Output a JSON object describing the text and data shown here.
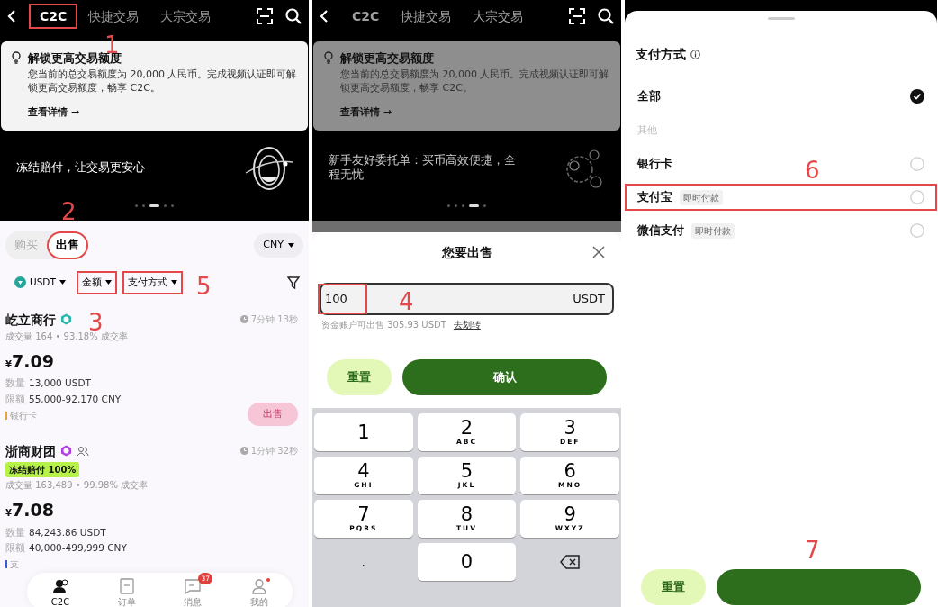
{
  "panels": [
    {
      "kind": "market",
      "header": {
        "tabs": [
          {
            "label": "C2C",
            "selected": true,
            "highlighted": true
          },
          {
            "label": "快捷交易",
            "selected": false,
            "highlighted": false
          },
          {
            "label": "大宗交易",
            "selected": false,
            "highlighted": false
          }
        ]
      },
      "notice": {
        "title": "解锁更高交易额度",
        "body": "您当前的总交易额度为 20,000 人民币。完成视频认证即可解锁更高交易额度，畅享 C2C。",
        "link": "查看详情 →"
      },
      "banner": {
        "text": "冻结赔付，让交易更安心",
        "kind": "ring",
        "dots": [
          {
            "selected": false
          },
          {
            "selected": false
          },
          {
            "selected": true
          },
          {
            "selected": false
          },
          {
            "selected": false
          }
        ]
      },
      "side_tabs": [
        {
          "label": "购买",
          "selected": false,
          "highlighted": false
        },
        {
          "label": "出售",
          "selected": true,
          "highlighted": true
        }
      ],
      "currency": "CNY",
      "filters": [
        {
          "label": "USDT",
          "kind": "coin",
          "highlighted": false
        },
        {
          "label": "金额",
          "kind": "plain",
          "highlighted": true
        },
        {
          "label": "支付方式",
          "kind": "plain",
          "highlighted": true
        }
      ],
      "offers": [
        {
          "name": "屹立商行",
          "badge": {
            "color": "#2bb5ad"
          },
          "group": false,
          "timer": "7分钟 13秒",
          "stats": "成交量 164 • 93.18% 成交率",
          "currency_sign": "¥",
          "price": "7.09",
          "quantity_label": "数量",
          "quantity": "13,000 USDT",
          "limit_label": "限额",
          "limit": "55,000-92,170 CNY",
          "payment": {
            "label": "银行卡",
            "color": "#f0a030"
          },
          "button": "出售"
        },
        {
          "name": "浙商财团",
          "badge": {
            "color": "#b040e0"
          },
          "group": true,
          "tag": "冻结赔付 100%",
          "timer": "1分钟 32秒",
          "stats": "成交量 163,489 • 99.98% 成交率",
          "currency_sign": "¥",
          "price": "7.08",
          "quantity_label": "数量",
          "quantity": "84,243.86 USDT",
          "limit_label": "限额",
          "limit": "40,000-499,999 CNY",
          "payment": {
            "label": "支",
            "color": "#3a5bd9"
          }
        }
      ],
      "bottom_nav": [
        {
          "label": "C2C",
          "selected": true,
          "dot": false
        },
        {
          "label": "订单",
          "selected": false,
          "dot": false
        },
        {
          "label": "消息",
          "selected": false,
          "badge": "37",
          "dot": false
        },
        {
          "label": "我的",
          "selected": false,
          "dot": true
        }
      ],
      "annotations": [
        "1",
        "2",
        "3",
        "5"
      ]
    },
    {
      "kind": "sell_sheet",
      "header": {
        "tabs": [
          {
            "label": "C2C",
            "selected": true,
            "highlighted": false
          },
          {
            "label": "快捷交易",
            "selected": false,
            "highlighted": false
          },
          {
            "label": "大宗交易",
            "selected": false,
            "highlighted": false
          }
        ]
      },
      "notice": {
        "title": "解锁更高交易额度",
        "body": "您当前的总交易额度为 20,000 人民币。完成视频认证即可解锁更高交易额度，畅享 C2C。",
        "link": "查看详情 →"
      },
      "banner": {
        "text": "新手友好委托单：买币高效便捷，全程无忧",
        "kind": "people",
        "dots": [
          {
            "selected": false
          },
          {
            "selected": false
          },
          {
            "selected": false
          },
          {
            "selected": true
          },
          {
            "selected": false
          }
        ]
      },
      "sheet": {
        "title": "您要出售",
        "amount": {
          "value": "100",
          "unit": "USDT",
          "highlighted": true
        },
        "hint": "资金账户可出售 305.93 USDT",
        "link": "去划转",
        "buttons": [
          {
            "label": "重置",
            "kind": "secondary"
          },
          {
            "label": "确认",
            "kind": "primary"
          }
        ]
      },
      "keypad": [
        {
          "kind": "key",
          "digit": "1"
        },
        {
          "kind": "key",
          "digit": "2",
          "letters": "ABC"
        },
        {
          "kind": "key",
          "digit": "3",
          "letters": "DEF"
        },
        {
          "kind": "key",
          "digit": "4",
          "letters": "GHI"
        },
        {
          "kind": "key",
          "digit": "5",
          "letters": "JKL"
        },
        {
          "kind": "key",
          "digit": "6",
          "letters": "MNO"
        },
        {
          "kind": "key",
          "digit": "7",
          "letters": "PQRS"
        },
        {
          "kind": "key",
          "digit": "8",
          "letters": "TUV"
        },
        {
          "kind": "key",
          "digit": "9",
          "letters": "WXYZ"
        },
        {
          "kind": "bare",
          "digit": "."
        },
        {
          "kind": "key",
          "digit": "0"
        },
        {
          "kind": "backspace"
        }
      ],
      "annotations": [
        "4"
      ]
    },
    {
      "kind": "payment_sheet",
      "sheet": {
        "title": "支付方式",
        "options": [
          {
            "kind": "option",
            "label": "全部",
            "checked": true,
            "highlighted": false
          },
          {
            "kind": "section",
            "label": "其他"
          },
          {
            "kind": "option",
            "label": "银行卡",
            "checked": false,
            "highlighted": false
          },
          {
            "kind": "option",
            "label": "支付宝",
            "tag": "即时付款",
            "checked": false,
            "highlighted": true
          },
          {
            "kind": "option",
            "label": "微信支付",
            "tag": "即时付款",
            "checked": false,
            "highlighted": false
          }
        ],
        "buttons": [
          {
            "label": "重置",
            "kind": "secondary"
          },
          {
            "kind": "primary"
          }
        ]
      },
      "annotations": [
        "6",
        "7"
      ]
    }
  ]
}
